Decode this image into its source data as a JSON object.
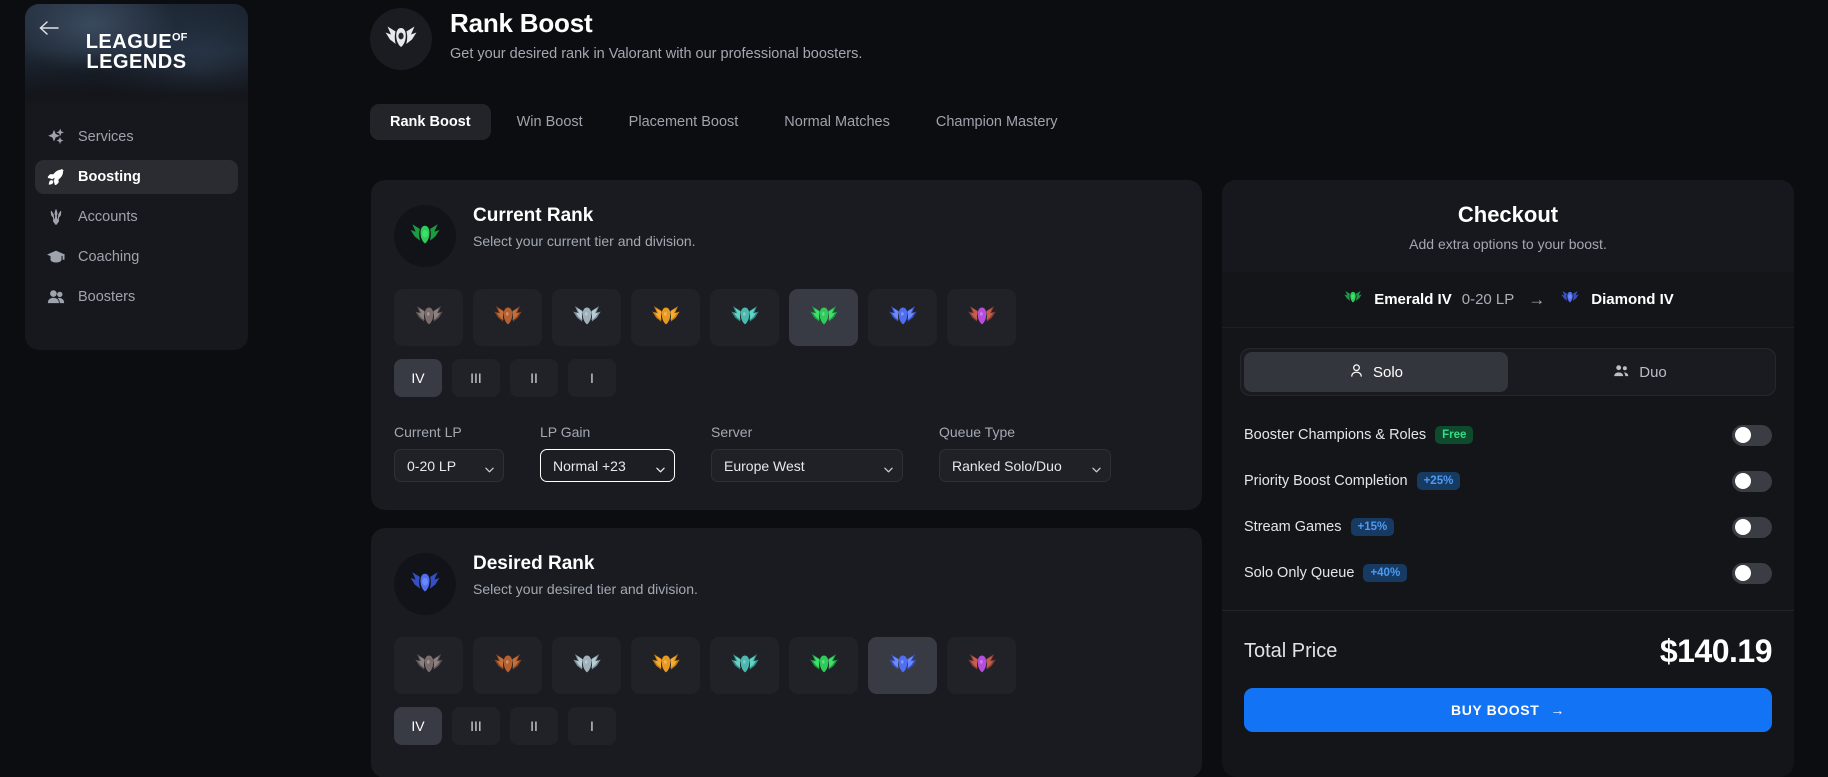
{
  "sidebar": {
    "back_icon": "arrow-left-icon",
    "logo_line1": "LEAGUE",
    "logo_of": "OF",
    "logo_line2": "LEGENDS",
    "items": [
      {
        "label": "Services",
        "icon": "sparkles-icon",
        "active": false
      },
      {
        "label": "Boosting",
        "icon": "rocket-icon",
        "active": true
      },
      {
        "label": "Accounts",
        "icon": "trident-icon",
        "active": false
      },
      {
        "label": "Coaching",
        "icon": "graduation-cap-icon",
        "active": false
      },
      {
        "label": "Boosters",
        "icon": "people-icon",
        "active": false
      }
    ]
  },
  "header": {
    "emblem_icon": "winged-crest-icon",
    "title": "Rank Boost",
    "subtitle": "Get your desired rank in Valorant with our professional boosters."
  },
  "tabs": [
    {
      "label": "Rank Boost",
      "active": true
    },
    {
      "label": "Win Boost",
      "active": false
    },
    {
      "label": "Placement Boost",
      "active": false
    },
    {
      "label": "Normal Matches",
      "active": false
    },
    {
      "label": "Champion Mastery",
      "active": false
    }
  ],
  "ranks": [
    {
      "name": "Iron",
      "orb": "#7b6d6d",
      "wing": "#8d8080",
      "wing2": "#5e5454"
    },
    {
      "name": "Bronze",
      "orb": "#b5612f",
      "wing": "#c4703a",
      "wing2": "#8d451f"
    },
    {
      "name": "Silver",
      "orb": "#9fb2bb",
      "wing": "#b9ccd4",
      "wing2": "#7e929c"
    },
    {
      "name": "Gold",
      "orb": "#e8991f",
      "wing": "#f4ad32",
      "wing2": "#c97c10"
    },
    {
      "name": "Platinum",
      "orb": "#4cb9ae",
      "wing": "#63d2c4",
      "wing2": "#2f8e86"
    },
    {
      "name": "Emerald",
      "orb": "#2ecb5a",
      "wing": "#3ce06a",
      "wing2": "#1d9a42"
    },
    {
      "name": "Diamond",
      "orb": "#4f6ef0",
      "wing": "#6d89ff",
      "wing2": "#3650c4"
    },
    {
      "name": "Master",
      "orb": "#b74ddc",
      "wing": "#c4604a",
      "wing2": "#8f3b35"
    }
  ],
  "divisions": [
    "IV",
    "III",
    "II",
    "I"
  ],
  "current_rank": {
    "emblem_icon": "emerald-crest-icon",
    "title": "Current Rank",
    "subtitle": "Select your current tier and division.",
    "selected_tier": "Emerald",
    "selected_tier_index": 5,
    "selected_division": "IV",
    "fields": [
      {
        "key": "current_lp",
        "label": "Current LP",
        "value": "0-20 LP",
        "focused": false
      },
      {
        "key": "lp_gain",
        "label": "LP Gain",
        "value": "Normal +23",
        "focused": true
      },
      {
        "key": "server",
        "label": "Server",
        "value": "Europe West",
        "focused": false
      },
      {
        "key": "queue_type",
        "label": "Queue Type",
        "value": "Ranked Solo/Duo",
        "focused": false
      }
    ]
  },
  "desired_rank": {
    "emblem_icon": "diamond-crest-icon",
    "title": "Desired Rank",
    "subtitle": "Select your desired tier and division.",
    "selected_tier": "Diamond",
    "selected_tier_index": 6,
    "selected_division": "IV"
  },
  "checkout": {
    "title": "Checkout",
    "subtitle": "Add extra options to your boost.",
    "summary": {
      "from_rank": "Emerald IV",
      "from_lp": "0-20 LP",
      "arrow": "→",
      "to_rank": "Diamond IV"
    },
    "mode": {
      "solo_label": "Solo",
      "solo_icon": "single-person-icon",
      "duo_label": "Duo",
      "duo_icon": "two-people-icon",
      "selected": "Solo"
    },
    "options": [
      {
        "label": "Booster Champions & Roles",
        "badge": "Free",
        "badge_type": "free",
        "enabled": false
      },
      {
        "label": "Priority Boost Completion",
        "badge": "+25%",
        "badge_type": "pct",
        "enabled": false
      },
      {
        "label": "Stream Games",
        "badge": "+15%",
        "badge_type": "pct",
        "enabled": false
      },
      {
        "label": "Solo Only Queue",
        "badge": "+40%",
        "badge_type": "pct",
        "enabled": false
      }
    ],
    "total_label": "Total Price",
    "total_value": "$140.19",
    "buy_label": "BUY BOOST",
    "buy_arrow": "→"
  },
  "colors": {
    "accent_blue": "#1373f5",
    "toggle_on": "#2563eb",
    "badge_free_bg": "#0e4a2c",
    "badge_free_text": "#39d98a",
    "badge_pct_bg": "#173a63",
    "badge_pct_text": "#4d9bf5",
    "page_bg": "#0c0d10",
    "card_bg": "#1a1b20"
  }
}
